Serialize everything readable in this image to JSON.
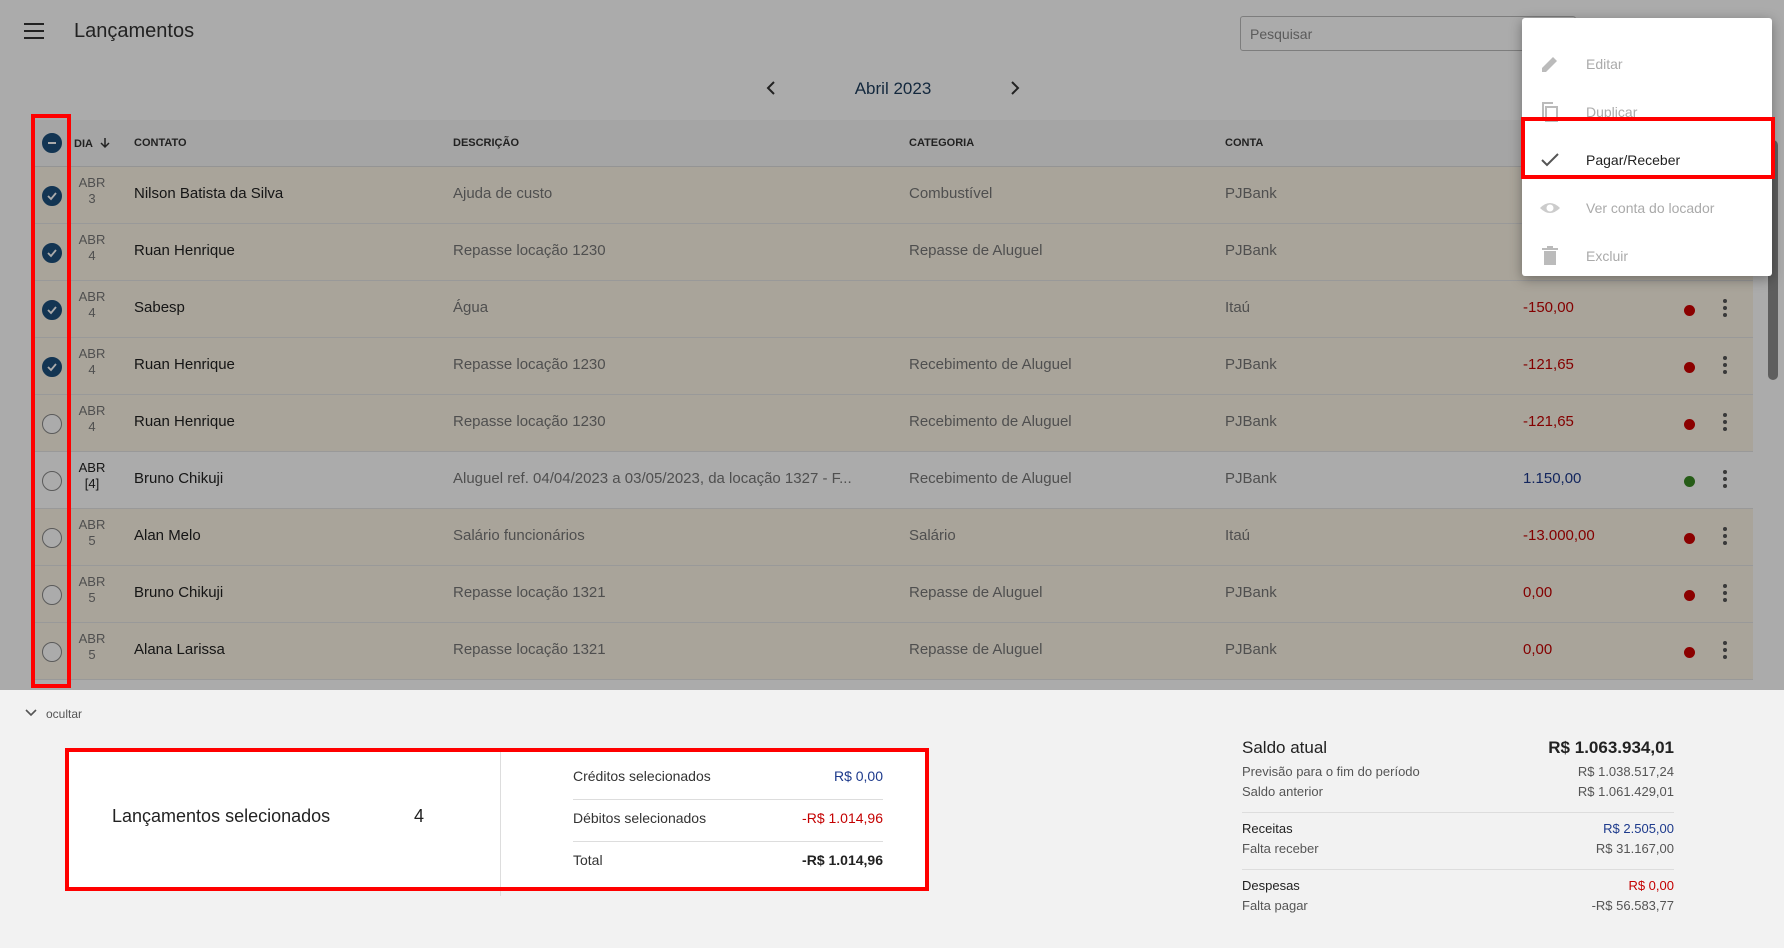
{
  "header": {
    "title": "Lançamentos",
    "search_placeholder": "Pesquisar"
  },
  "month_nav": {
    "label": "Abril 2023"
  },
  "table": {
    "columns": {
      "dia": "DIA",
      "contato": "CONTATO",
      "descricao": "DESCRIÇÃO",
      "categoria": "CATEGORIA",
      "conta": "CONTA"
    },
    "rows": [
      {
        "checked": true,
        "month": "ABR",
        "day": "3",
        "contact": "Nilson Batista da Silva",
        "description": "Ajuda de custo",
        "category": "Combustível",
        "account": "PJBank",
        "amount": "",
        "amount_color": "",
        "status": ""
      },
      {
        "checked": true,
        "month": "ABR",
        "day": "4",
        "contact": "Ruan Henrique",
        "description": "Repasse locação 1230",
        "category": "Repasse de Aluguel",
        "account": "PJBank",
        "amount": "",
        "amount_color": "",
        "status": ""
      },
      {
        "checked": true,
        "month": "ABR",
        "day": "4",
        "contact": "Sabesp",
        "description": "Água",
        "category": "",
        "account": "Itaú",
        "amount": "-150,00",
        "amount_color": "neg",
        "status": "red"
      },
      {
        "checked": true,
        "month": "ABR",
        "day": "4",
        "contact": "Ruan Henrique",
        "description": "Repasse locação 1230",
        "category": "Recebimento de Aluguel",
        "account": "PJBank",
        "amount": "-121,65",
        "amount_color": "neg",
        "status": "red"
      },
      {
        "checked": false,
        "month": "ABR",
        "day": "4",
        "contact": "Ruan Henrique",
        "description": "Repasse locação 1230",
        "category": "Recebimento de Aluguel",
        "account": "PJBank",
        "amount": "-121,65",
        "amount_color": "neg",
        "status": "red"
      },
      {
        "checked": false,
        "month": "ABR",
        "day": "[4]",
        "contact": "Bruno Chikuji",
        "description": "Aluguel ref. 04/04/2023 a 03/05/2023, da locação 1327 - F...",
        "category": "Recebimento de Aluguel",
        "account": "PJBank",
        "amount": "1.150,00",
        "amount_color": "pos",
        "status": "green"
      },
      {
        "checked": false,
        "month": "ABR",
        "day": "5",
        "contact": "Alan Melo",
        "description": "Salário funcionários",
        "category": "Salário",
        "account": "Itaú",
        "amount": "-13.000,00",
        "amount_color": "neg",
        "status": "red"
      },
      {
        "checked": false,
        "month": "ABR",
        "day": "5",
        "contact": "Bruno Chikuji",
        "description": "Repasse locação 1321",
        "category": "Repasse de Aluguel",
        "account": "PJBank",
        "amount": "0,00",
        "amount_color": "neg",
        "status": "red"
      },
      {
        "checked": false,
        "month": "ABR",
        "day": "5",
        "contact": "Alana Larissa",
        "description": "Repasse locação 1321",
        "category": "Repasse de Aluguel",
        "account": "PJBank",
        "amount": "0,00",
        "amount_color": "neg",
        "status": "red"
      }
    ]
  },
  "context_menu": {
    "items": [
      {
        "label": "Editar",
        "icon": "pencil-icon",
        "active": false
      },
      {
        "label": "Duplicar",
        "icon": "copy-icon",
        "active": false
      },
      {
        "label": "Pagar/Receber",
        "icon": "check-icon",
        "active": true
      },
      {
        "label": "Ver conta do locador",
        "icon": "eye-icon",
        "active": false
      },
      {
        "label": "Excluir",
        "icon": "trash-icon",
        "active": false
      }
    ]
  },
  "footer": {
    "hide_label": "ocultar",
    "selection": {
      "label": "Lançamentos selecionados",
      "count": "4",
      "credits_label": "Créditos selecionados",
      "credits_value": "R$ 0,00",
      "debits_label": "Débitos selecionados",
      "debits_value": "-R$ 1.014,96",
      "total_label": "Total",
      "total_value": "-R$ 1.014,96"
    },
    "balance": {
      "current_label": "Saldo atual",
      "current_value": "R$ 1.063.934,01",
      "forecast_label": "Previsão para o fim do período",
      "forecast_value": "R$ 1.038.517,24",
      "previous_label": "Saldo anterior",
      "previous_value": "R$ 1.061.429,01",
      "income_label": "Receitas",
      "income_value": "R$ 2.505,00",
      "to_receive_label": "Falta receber",
      "to_receive_value": "R$ 31.167,00",
      "expenses_label": "Despesas",
      "expenses_value": "R$ 0,00",
      "to_pay_label": "Falta pagar",
      "to_pay_value": "-R$ 56.583,77"
    }
  },
  "colors": {
    "accent": "#1d4f7c",
    "negative": "#c40000",
    "positive": "#1d3a8c",
    "highlight": "#ff0000"
  }
}
